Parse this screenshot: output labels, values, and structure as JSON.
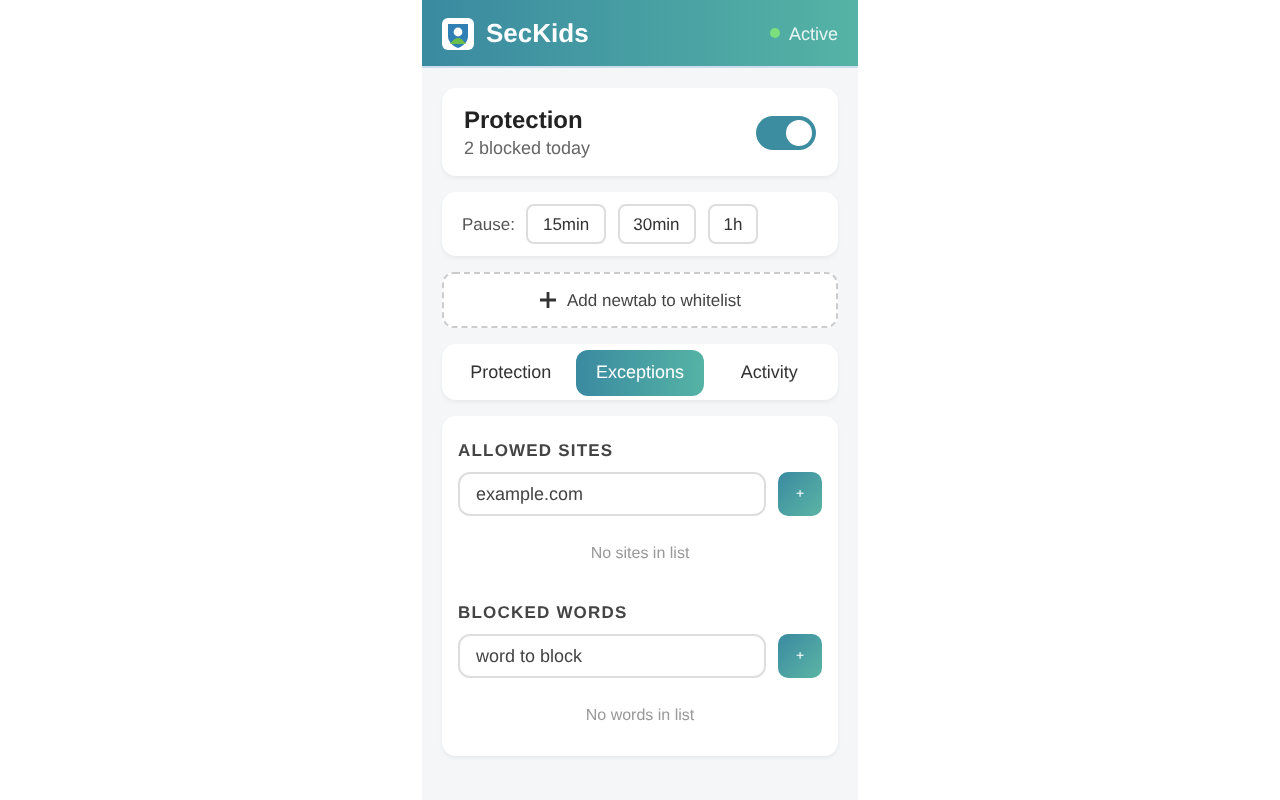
{
  "header": {
    "title": "SecKids",
    "status": "Active",
    "active": true
  },
  "protection": {
    "title": "Protection",
    "subtitle": "2 blocked today",
    "on": true
  },
  "pause": {
    "label": "Pause:",
    "options": [
      "15min",
      "30min",
      "1h"
    ]
  },
  "whitelist_button": "Add newtab to whitelist",
  "tabs": [
    {
      "label": "Protection",
      "selected": false
    },
    {
      "label": "Exceptions",
      "selected": true
    },
    {
      "label": "Activity",
      "selected": false
    }
  ],
  "sections": [
    {
      "heading": "ALLOWED SITES",
      "placeholder": "example.com",
      "add": "+",
      "empty": "No sites in list"
    },
    {
      "heading": "BLOCKED WORDS",
      "placeholder": "word to block",
      "add": "+",
      "empty": "No words in list"
    }
  ]
}
